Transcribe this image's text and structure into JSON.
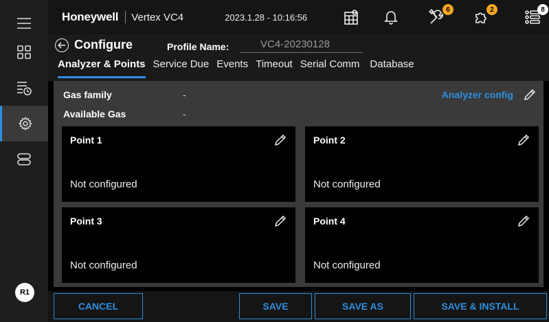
{
  "header": {
    "brand": "Honeywell",
    "device": "Vertex VC4",
    "datetime": "2023.1.28 - 10:16:56",
    "maintenance_badge": "6",
    "alerts_badge": "2",
    "list_badge": "8"
  },
  "sidebar": {
    "role_badge": "R1"
  },
  "title": {
    "page_title": "Configure",
    "profile_label": "Profile Name:",
    "profile_value": "VC4-20230128"
  },
  "tabs": [
    {
      "label": "Analyzer & Points",
      "active": true
    },
    {
      "label": "Service Due"
    },
    {
      "label": "Events"
    },
    {
      "label": "Timeout"
    },
    {
      "label": "Serial Comm"
    },
    {
      "label": "Database"
    }
  ],
  "main": {
    "gas_family_label": "Gas family",
    "gas_family_value": "-",
    "available_gas_label": "Available Gas",
    "available_gas_value": "-",
    "analyzer_config_link": "Analyzer config",
    "points": [
      {
        "title": "Point 1",
        "status": "Not configured"
      },
      {
        "title": "Point 2",
        "status": "Not configured"
      },
      {
        "title": "Point 3",
        "status": "Not configured"
      },
      {
        "title": "Point 4",
        "status": "Not configured"
      }
    ]
  },
  "footer": {
    "cancel": "CANCEL",
    "save": "SAVE",
    "save_as": "SAVE AS",
    "save_install": "SAVE & INSTALL"
  },
  "colors": {
    "accent": "#2d8fe0",
    "badge": "#f5a623"
  }
}
